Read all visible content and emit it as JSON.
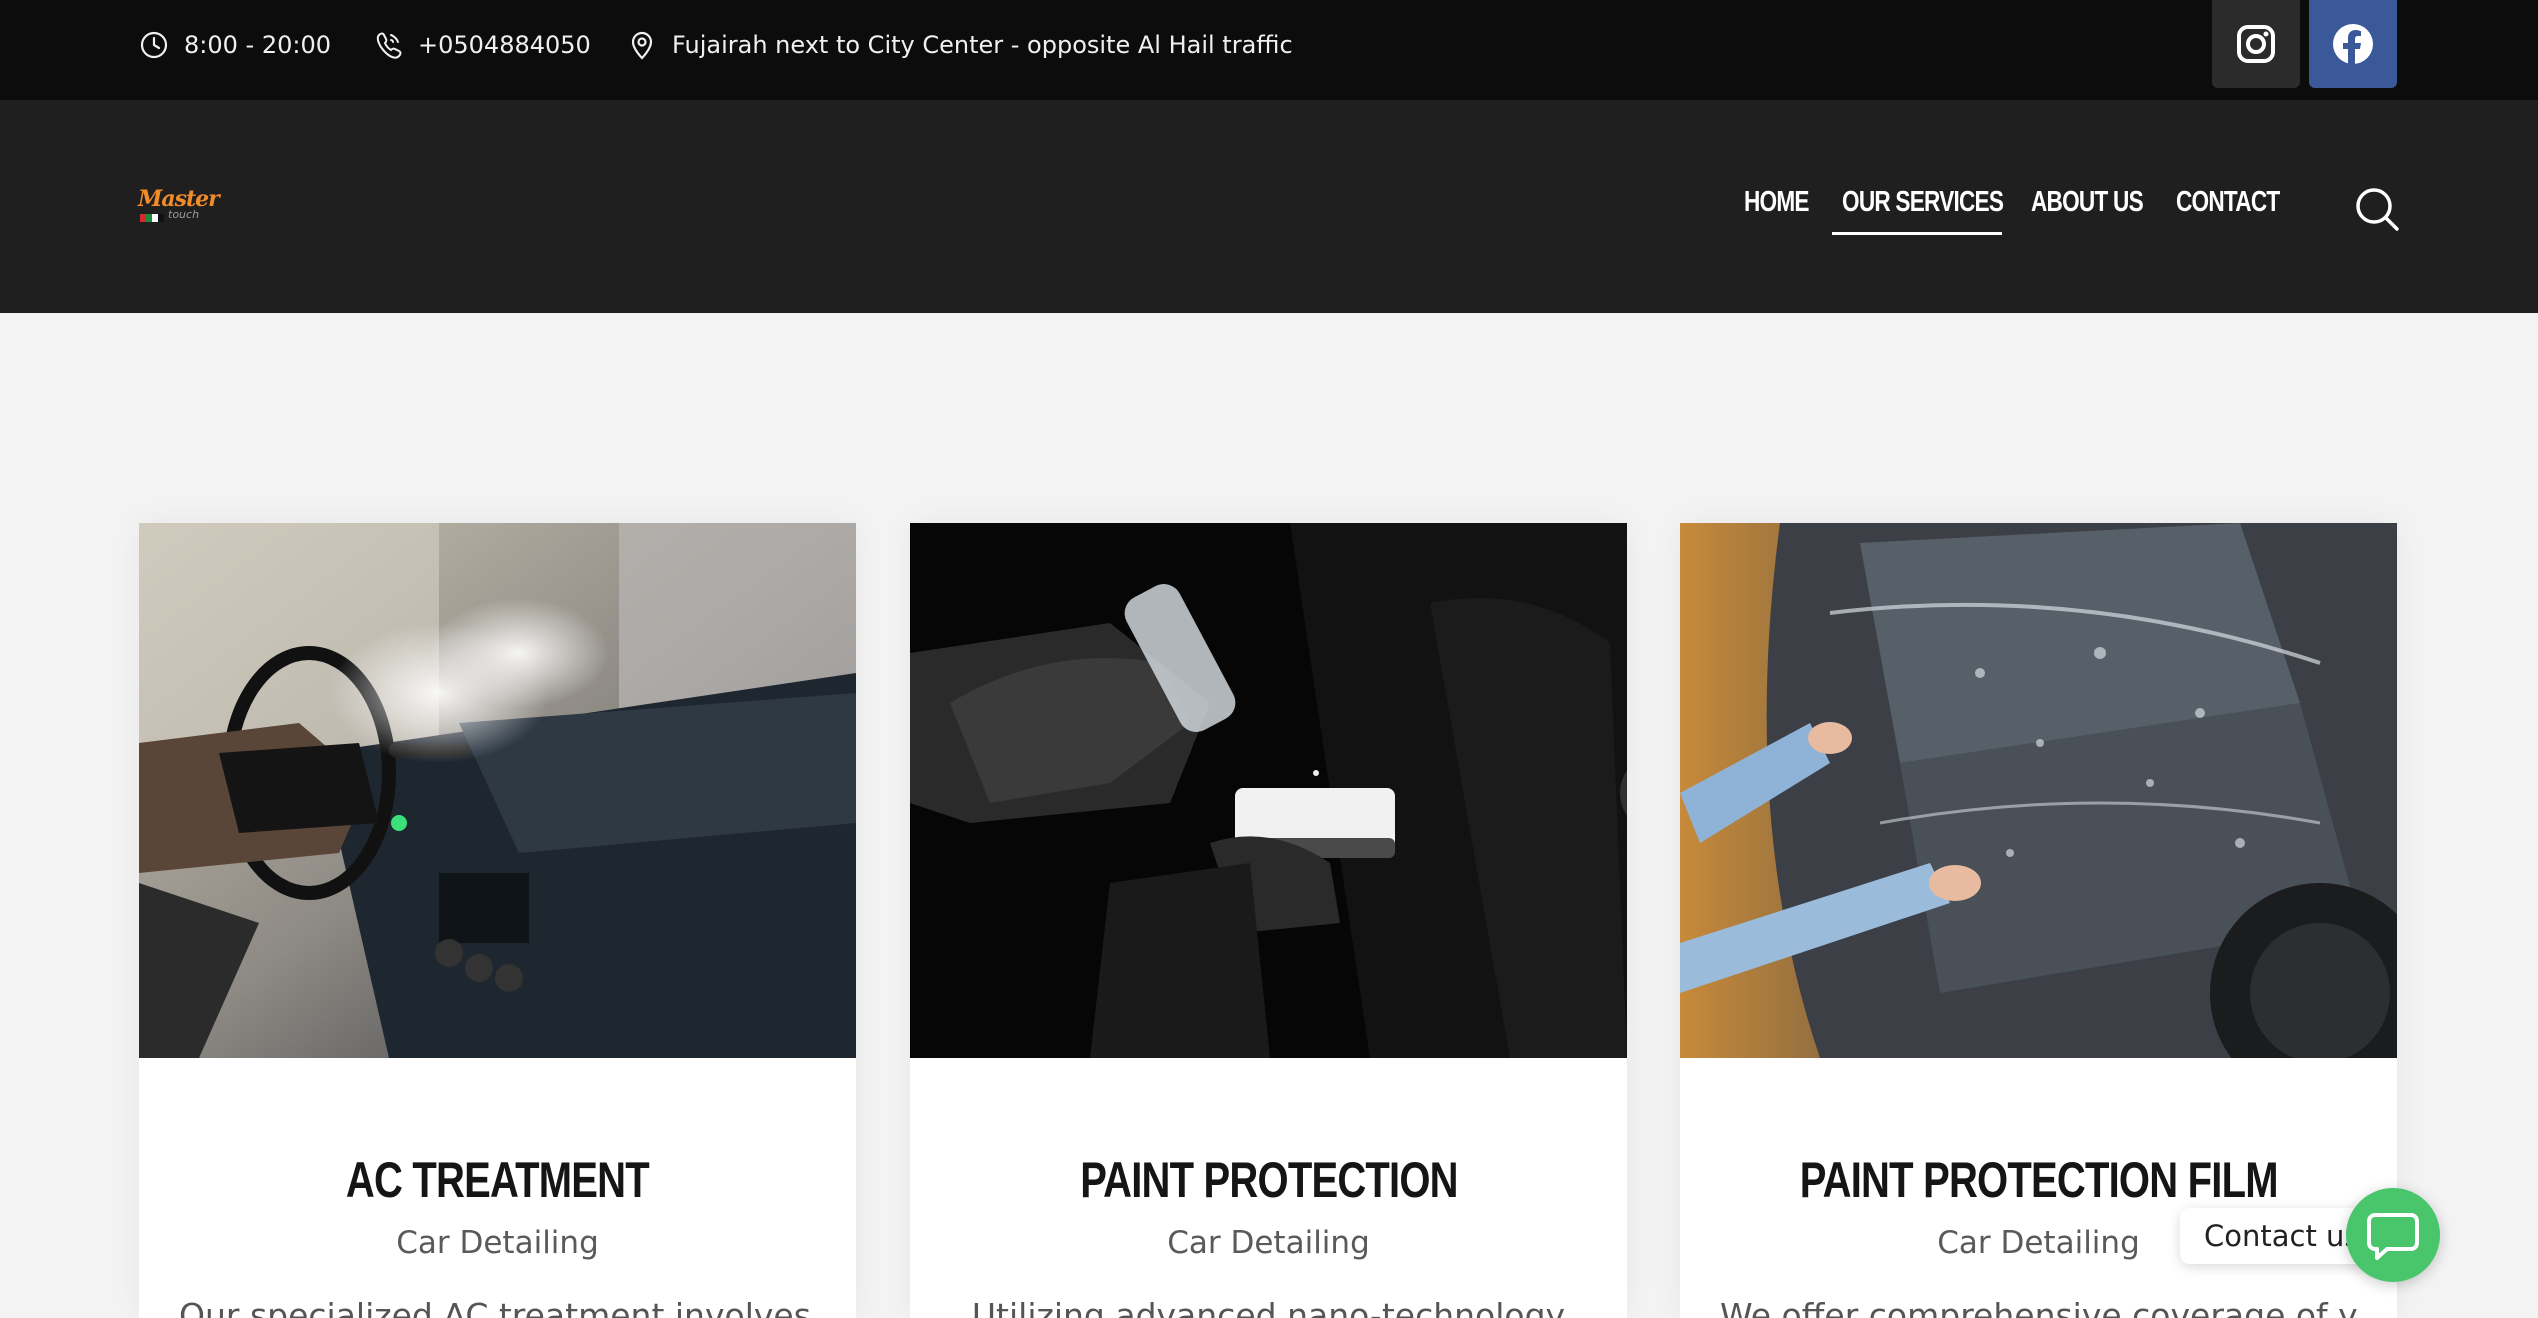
{
  "topbar": {
    "hours": "8:00 - 20:00",
    "phone": "+0504884050",
    "address": "Fujairah next to City Center - opposite Al Hail traffic",
    "social": [
      {
        "icon": "instagram-icon",
        "color": "#2b2b2b"
      },
      {
        "icon": "facebook-icon",
        "color": "#3b5998"
      }
    ]
  },
  "header": {
    "logo": {
      "main": "Master",
      "sub": "touch"
    },
    "nav": [
      {
        "label": "HOME",
        "active": false
      },
      {
        "label": "OUR SERVICES",
        "active": true
      },
      {
        "label": "ABOUT US",
        "active": false
      },
      {
        "label": "CONTACT",
        "active": false
      }
    ],
    "search_icon": "search-icon"
  },
  "services": [
    {
      "title": "AC TREATMENT",
      "category": "Car Detailing",
      "description": "Our specialized AC treatment involves a"
    },
    {
      "title": "PAINT PROTECTION",
      "category": "Car Detailing",
      "description": "Utilizing advanced nano-technology"
    },
    {
      "title": "PAINT PROTECTION FILM",
      "category": "Car Detailing",
      "description": "We offer comprehensive coverage of your"
    }
  ],
  "contact_widget": {
    "label": "Contact us",
    "color": "#49c56b"
  },
  "colors": {
    "topbar": "#0c0c0c",
    "header": "#1f1f1f",
    "background": "#f3f3f3",
    "logo_accent": "#f28c28"
  }
}
